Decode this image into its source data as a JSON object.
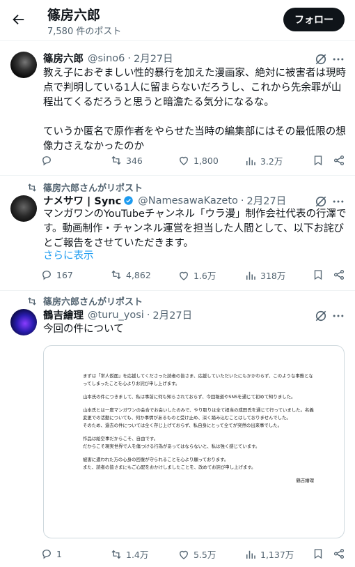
{
  "header": {
    "title": "篠房六郎",
    "subtitle": "7,580 件のポスト",
    "follow_label": "フォロー"
  },
  "posts": [
    {
      "name": "篠房六郎",
      "handle": "@sino6",
      "date": "2月27日",
      "text": "教え子におぞましい性的暴行を加えた漫画家、絶対に被害者は現時点で判明している1人に留まらないだろうし、これから先余罪が山程出てくるだろうと思うと暗澹たる気分になるな。\n\nていうか匿名で原作者をやらせた当時の編集部にはその最低限の想像力さえなかったのか",
      "replies": "",
      "reposts": "346",
      "likes": "1,800",
      "views": "3.2万"
    },
    {
      "repost_label": "篠房六郎さんがリポスト",
      "name": "ナメサワ | Sync",
      "handle": "@NamesawaKazeto",
      "date": "2月27日",
      "text": "マンガワンのYouTubeチャンネル「ウラ漫」制作会社代表の行澤です。動画制作・チャンネル運営を担当した人間として、以下お詫びとご報告をさせていただきます。",
      "show_more": "さらに表示",
      "replies": "167",
      "reposts": "4,862",
      "likes": "1.6万",
      "views": "318万"
    },
    {
      "repost_label": "篠房六郎さんがリポスト",
      "name": "鶴吉繪理",
      "handle": "@turu_yosi",
      "date": "2月27日",
      "text": "今回の件について",
      "image_paragraphs": [
        "まずは「常人仮面」を応援してくださった読者の皆さま、応援していただいたにもかかわらず、このような事態となってしまったことを心よりお詫び申し上げます。",
        "山本氏の件につきまして、私は事前に何も知らされておらず、今回報道やSNSを通じて初めて知りました。",
        "山本氏とは一度マンガワンの会合でお会いしたのみで、やり取りは全て担当の成田氏を通じて行っていました。名義変更での活動についても、何か事情があるものと受け止め、深く踏み込むことはしておりませんでした。\nそのため、過去の件については全く存じ上げておらず、私自身にとって全てが突然の出来事でした。",
        "作品は絵空事だからこそ、自由です。\nだからこそ現実世界で人を傷つける行為があってはならないと、私は強く感じています。",
        "被害に遭われた方の心身の回復が守られることを心より願っております。\nまた、読者の皆さまにもご心配をおかけしましたことを、改めてお詫び申し上げます。"
      ],
      "image_signature": "鶴吉繪理",
      "replies": "1",
      "reposts": "1.4万",
      "likes": "5.5万",
      "views": "1,137万"
    }
  ],
  "colors": {
    "text": "#0f1419",
    "secondary": "#536471",
    "link": "#1d9bf0",
    "border": "#eff3f4"
  },
  "icons": [
    "back-arrow-icon",
    "grok-icon",
    "more-icon",
    "reply-icon",
    "repost-icon",
    "like-icon",
    "views-icon",
    "bookmark-icon",
    "share-icon",
    "verified-badge-icon"
  ]
}
